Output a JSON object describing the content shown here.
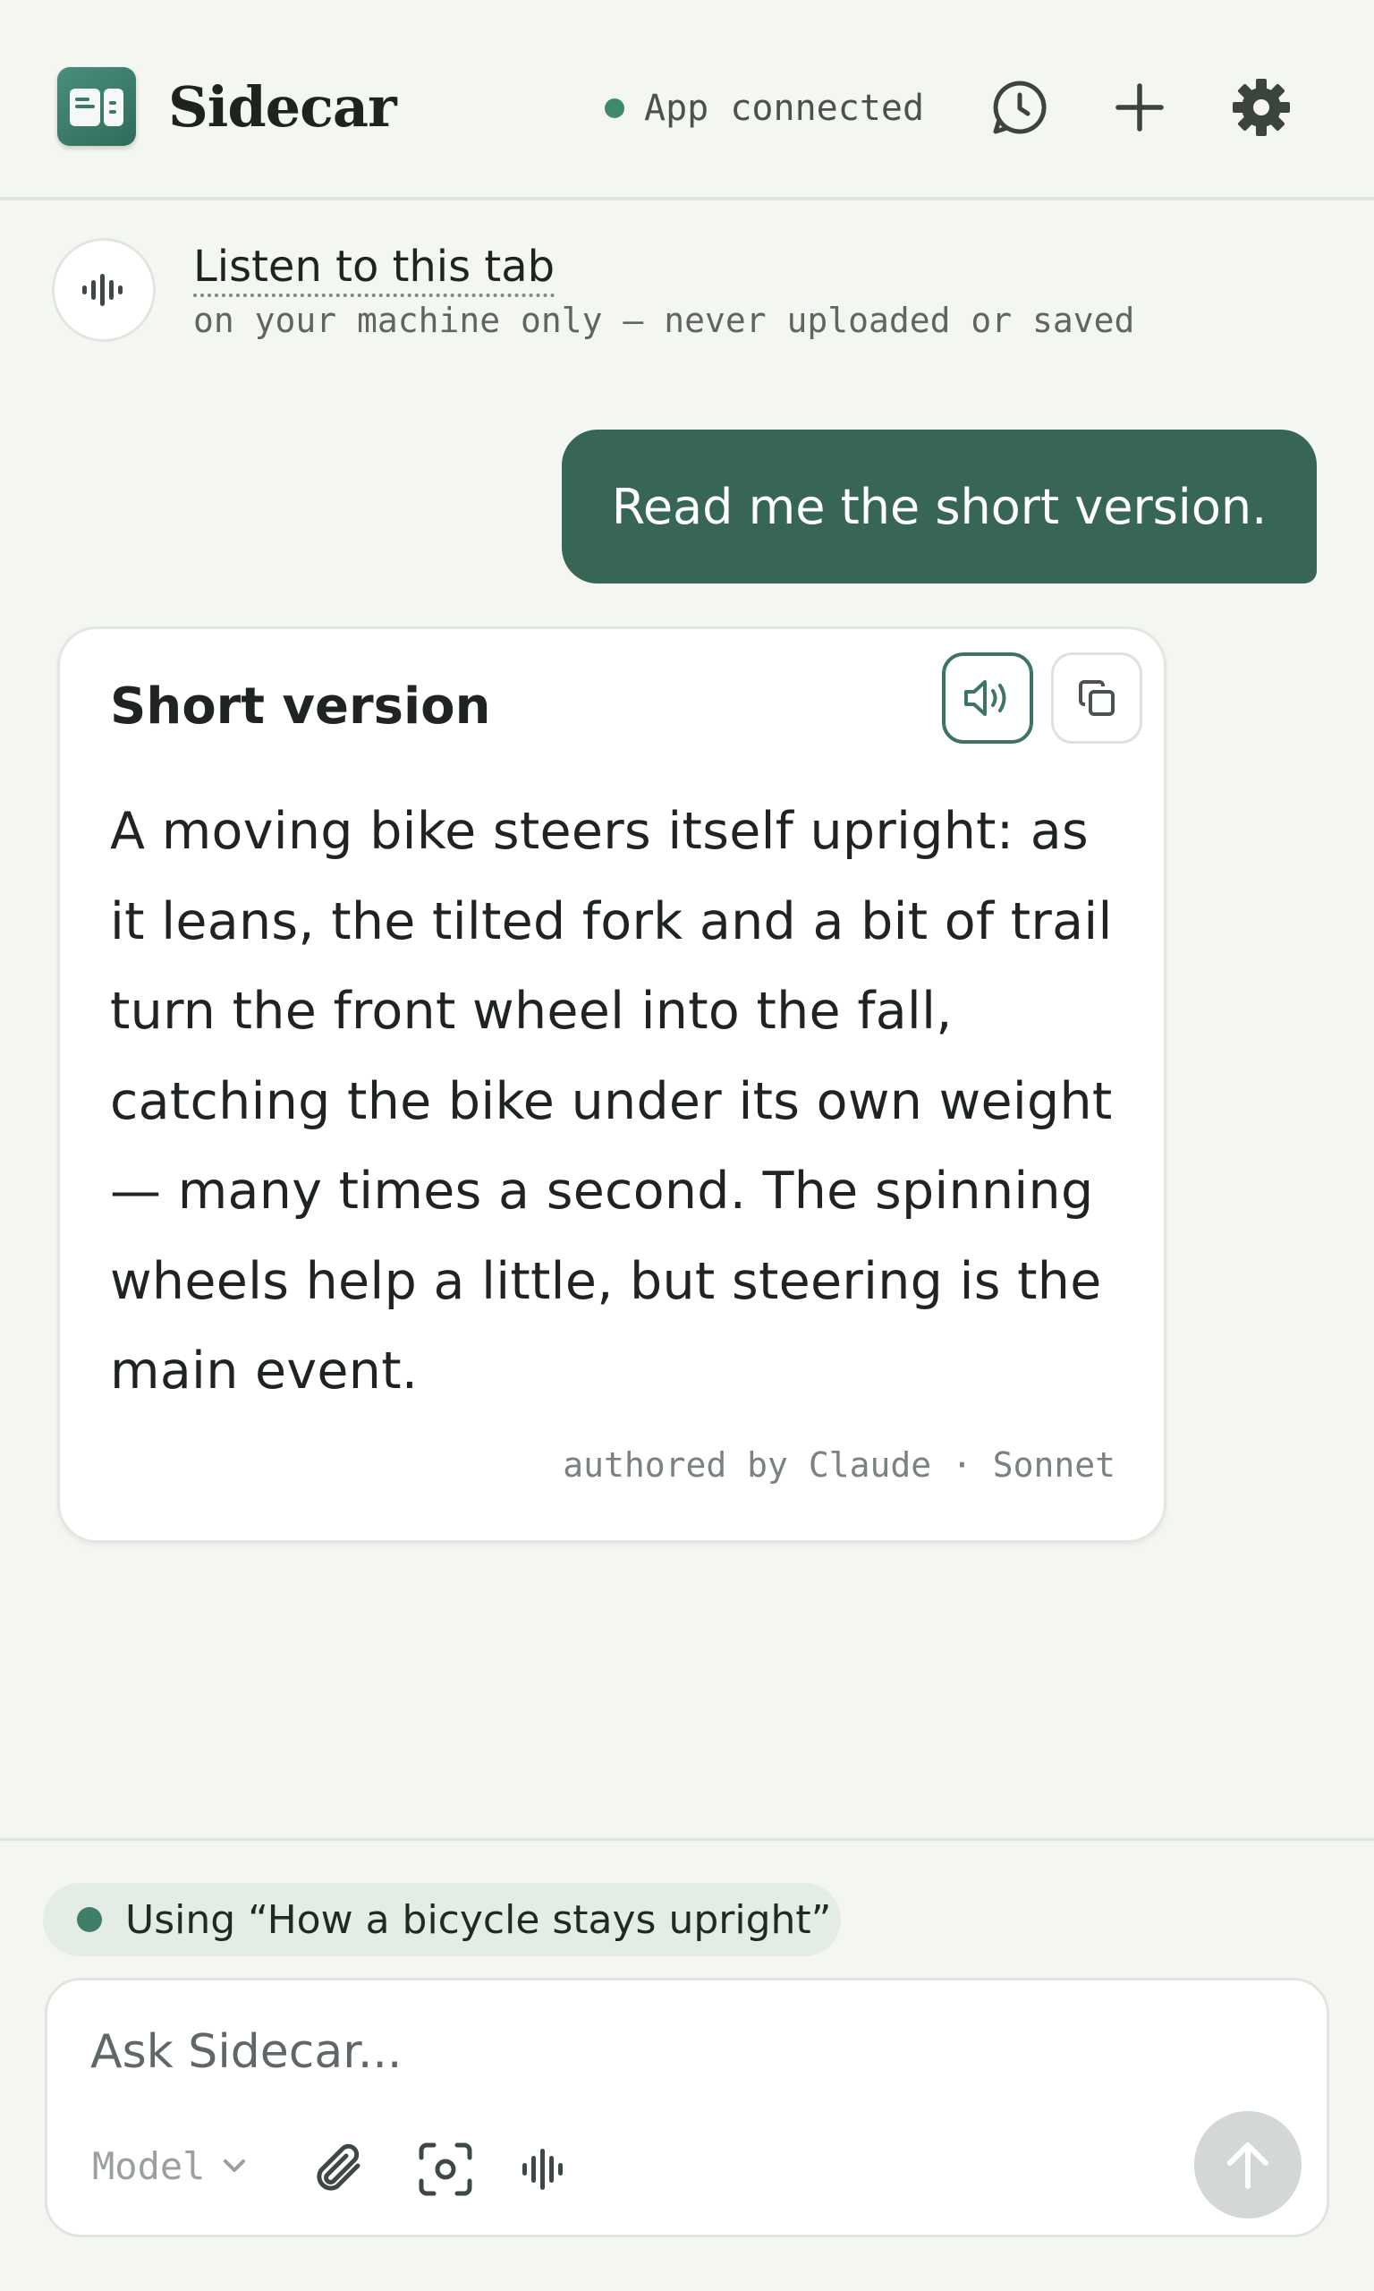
{
  "header": {
    "app_name": "Sidecar",
    "connection_status": "App connected",
    "icons": [
      "history-icon",
      "plus-icon",
      "gear-icon"
    ]
  },
  "listen": {
    "title": "Listen to this tab",
    "subtitle": "on your machine only — never uploaded or saved"
  },
  "conversation": {
    "user_message": "Read me the short version.",
    "response": {
      "title": "Short version",
      "body": "A moving bike steers itself upright: as it leans, the tilted fork and a bit of trail turn the front wheel into the fall, catching the bike under its own weight — many times a second. The spinning wheels help a little, but steering is the main event.",
      "attribution": "authored by Claude · Sonnet"
    }
  },
  "context": {
    "label": "Using “How a bicycle stays upright”"
  },
  "composer": {
    "placeholder": "Ask Sidecar...",
    "model_label": "Model"
  },
  "colors": {
    "accent": "#376656",
    "connected": "#3f8a6c",
    "background": "#f4f6f2"
  }
}
